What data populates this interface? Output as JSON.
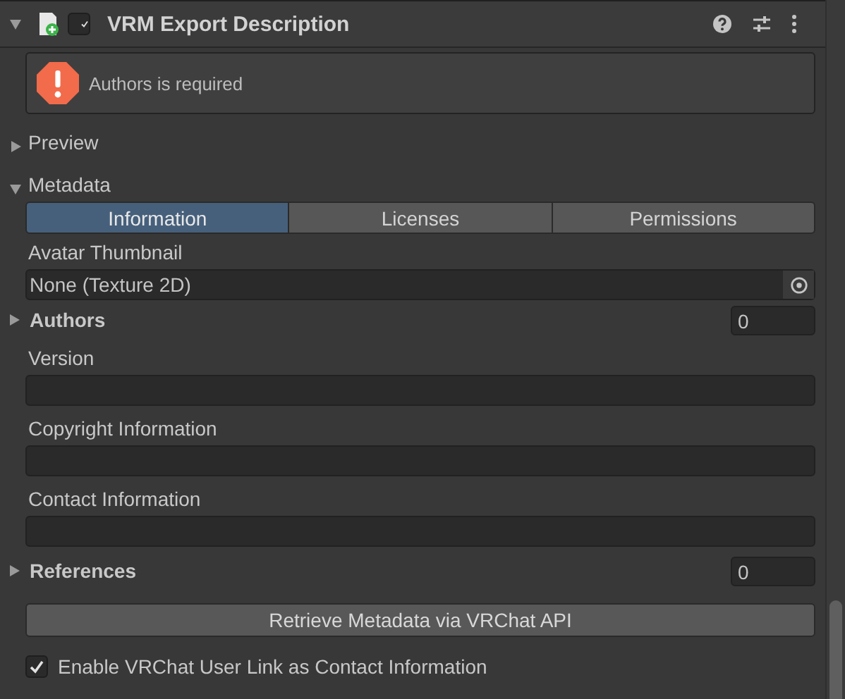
{
  "component": {
    "title": "VRM Export Description",
    "enabled": true,
    "expanded": true
  },
  "message": {
    "kind": "error",
    "text": "Authors is required"
  },
  "sections": [
    {
      "label": "Preview",
      "expanded": false
    },
    {
      "label": "Metadata",
      "expanded": true
    }
  ],
  "tabs": [
    {
      "label": "Information",
      "selected": true
    },
    {
      "label": "Licenses",
      "selected": false
    },
    {
      "label": "Permissions",
      "selected": false
    }
  ],
  "fields": [
    {
      "kind": "object",
      "label": "Avatar Thumbnail",
      "value": "None (Texture 2D)"
    },
    {
      "kind": "array",
      "label": "Authors",
      "count": "0",
      "expanded": false
    },
    {
      "kind": "text",
      "label": "Version"
    },
    {
      "kind": "text",
      "label": "Copyright Information"
    },
    {
      "kind": "text",
      "label": "Contact Information"
    },
    {
      "kind": "array",
      "label": "References",
      "count": "0",
      "expanded": false
    }
  ],
  "button": "Retrieve Metadata via VRChat API",
  "toggle": {
    "label": "Enable VRChat User Link as Contact Information",
    "checked": true
  }
}
